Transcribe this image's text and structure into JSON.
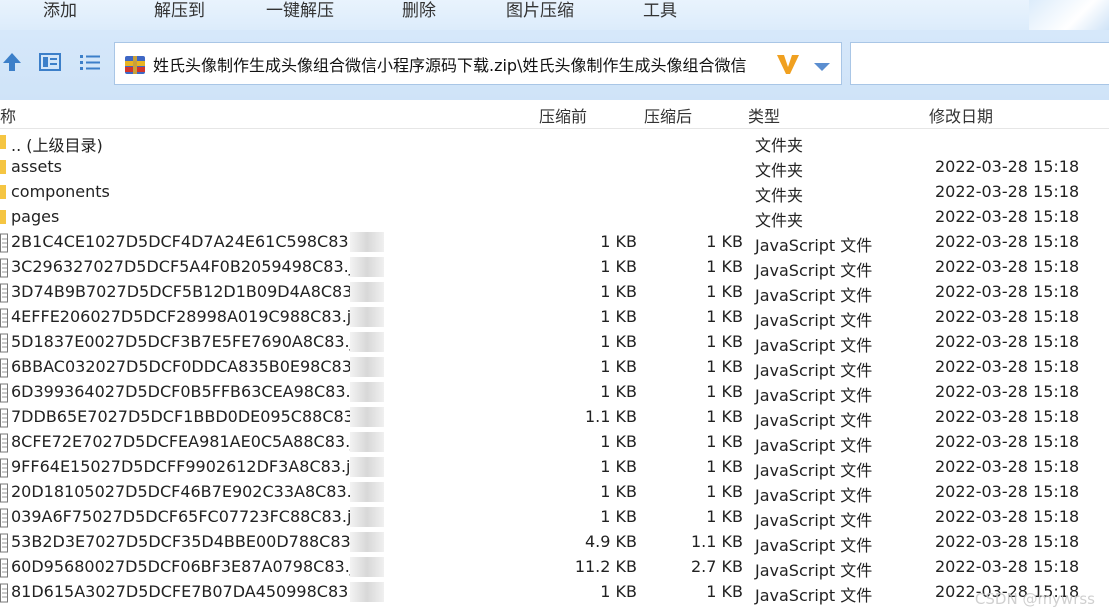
{
  "toolbar": {
    "add": "添加",
    "extract_to": "解压到",
    "one_click_extract": "一键解压",
    "delete": "删除",
    "image_compress": "图片压缩",
    "tools": "工具"
  },
  "address": {
    "path": "姓氏头像制作生成头像组合微信小程序源码下载.zip\\姓氏头像制作生成头像组合微信"
  },
  "columns": {
    "name": "称",
    "before": "压缩前",
    "after": "压缩后",
    "type": "类型",
    "modified": "修改日期"
  },
  "rows": [
    {
      "name": ".. (上级目录)",
      "before": "",
      "after": "",
      "type": "文件夹",
      "date": "",
      "kind": "folder"
    },
    {
      "name": "assets",
      "before": "",
      "after": "",
      "type": "文件夹",
      "date": "2022-03-28 15:18",
      "kind": "folder"
    },
    {
      "name": "components",
      "before": "",
      "after": "",
      "type": "文件夹",
      "date": "2022-03-28 15:18",
      "kind": "folder"
    },
    {
      "name": "pages",
      "before": "",
      "after": "",
      "type": "文件夹",
      "date": "2022-03-28 15:18",
      "kind": "folder"
    },
    {
      "name": "2B1C4CE1027D5DCF4D7A24E61C598C83.j",
      "before": "1 KB",
      "after": "1 KB",
      "type": "JavaScript 文件",
      "date": "2022-03-28 15:18",
      "kind": "file"
    },
    {
      "name": "3C296327027D5DCF5A4F0B2059498C83.j",
      "before": "1 KB",
      "after": "1 KB",
      "type": "JavaScript 文件",
      "date": "2022-03-28 15:18",
      "kind": "file"
    },
    {
      "name": "3D74B9B7027D5DCF5B12D1B09D4A8C83",
      "before": "1 KB",
      "after": "1 KB",
      "type": "JavaScript 文件",
      "date": "2022-03-28 15:18",
      "kind": "file"
    },
    {
      "name": "4EFFE206027D5DCF28998A019C988C83.j",
      "before": "1 KB",
      "after": "1 KB",
      "type": "JavaScript 文件",
      "date": "2022-03-28 15:18",
      "kind": "file"
    },
    {
      "name": "5D1837E0027D5DCF3B7E5FE7690A8C83.j",
      "before": "1 KB",
      "after": "1 KB",
      "type": "JavaScript 文件",
      "date": "2022-03-28 15:18",
      "kind": "file"
    },
    {
      "name": "6BBAC032027D5DCF0DDCA835B0E98C83",
      "before": "1 KB",
      "after": "1 KB",
      "type": "JavaScript 文件",
      "date": "2022-03-28 15:18",
      "kind": "file"
    },
    {
      "name": "6D399364027D5DCF0B5FFB63CEA98C83.j",
      "before": "1 KB",
      "after": "1 KB",
      "type": "JavaScript 文件",
      "date": "2022-03-28 15:18",
      "kind": "file"
    },
    {
      "name": "7DDB65E7027D5DCF1BBD0DE095C88C83.j",
      "before": "1.1 KB",
      "after": "1 KB",
      "type": "JavaScript 文件",
      "date": "2022-03-28 15:18",
      "kind": "file"
    },
    {
      "name": "8CFE72E7027D5DCFEA981AE0C5A88C83.js",
      "before": "1 KB",
      "after": "1 KB",
      "type": "JavaScript 文件",
      "date": "2022-03-28 15:18",
      "kind": "file"
    },
    {
      "name": "9FF64E15027D5DCFF9902612DF3A8C83.js",
      "before": "1 KB",
      "after": "1 KB",
      "type": "JavaScript 文件",
      "date": "2022-03-28 15:18",
      "kind": "file"
    },
    {
      "name": "20D18105027D5DCF46B7E902C33A8C83.js",
      "before": "1 KB",
      "after": "1 KB",
      "type": "JavaScript 文件",
      "date": "2022-03-28 15:18",
      "kind": "file"
    },
    {
      "name": "039A6F75027D5DCF65FC07723FC88C83.js",
      "before": "1 KB",
      "after": "1 KB",
      "type": "JavaScript 文件",
      "date": "2022-03-28 15:18",
      "kind": "file"
    },
    {
      "name": "53B2D3E7027D5DCF35D4BBE00D788C83.js",
      "before": "4.9 KB",
      "after": "1.1 KB",
      "type": "JavaScript 文件",
      "date": "2022-03-28 15:18",
      "kind": "file"
    },
    {
      "name": "60D95680027D5DCF06BF3E87A0798C83.js",
      "before": "11.2 KB",
      "after": "2.7 KB",
      "type": "JavaScript 文件",
      "date": "2022-03-28 15:18",
      "kind": "file"
    },
    {
      "name": "81D615A3027D5DCFE7B07DA450998C83.js",
      "before": "1 KB",
      "after": "1 KB",
      "type": "JavaScript 文件",
      "date": "2022-03-28 15:18",
      "kind": "file"
    }
  ],
  "watermark": "CSDN @mywrss",
  "colors": {
    "toolbar_bg": "#dcecfb",
    "address_border": "#a9c6e6",
    "folder": "#f5c542",
    "nav_icon": "#3c7fc9",
    "brand": "#f0a020"
  },
  "icons": {
    "back": "up-arrow-icon",
    "view": "view-details-icon",
    "list": "list-view-icon",
    "archive": "zip-archive-icon",
    "brand": "brand-v-icon",
    "dropdown": "chevron-down-icon"
  }
}
